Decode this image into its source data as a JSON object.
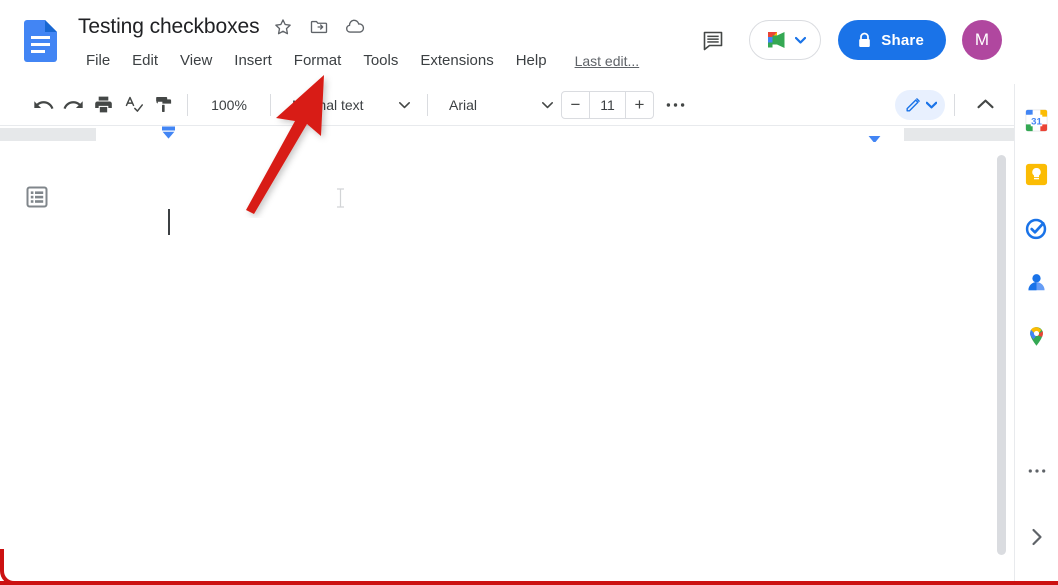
{
  "app": {
    "name": "Google Docs",
    "logo_icon": "google-docs-logo"
  },
  "header": {
    "doc_title": "Testing checkboxes",
    "title_icons": [
      {
        "name": "star-icon",
        "label": "Star"
      },
      {
        "name": "move-to-folder-icon",
        "label": "Move"
      },
      {
        "name": "cloud-saved-icon",
        "label": "See document status"
      }
    ],
    "menus": [
      {
        "label": "File"
      },
      {
        "label": "Edit"
      },
      {
        "label": "View"
      },
      {
        "label": "Insert"
      },
      {
        "label": "Format"
      },
      {
        "label": "Tools"
      },
      {
        "label": "Extensions"
      },
      {
        "label": "Help"
      }
    ],
    "last_edit": "Last edit...",
    "comment_icon": "comment-history-icon",
    "meet_icon": "google-meet-icon",
    "meet_caret_icon": "chevron-down-icon",
    "share_label": "Share",
    "share_lock_icon": "lock-icon",
    "avatar_initial": "M",
    "avatar_color": "#b0479f",
    "share_color": "#1a73e8"
  },
  "toolbar": {
    "undo_icon": "undo-icon",
    "redo_icon": "redo-icon",
    "print_icon": "print-icon",
    "spellcheck_icon": "spellcheck-icon",
    "paint_format_icon": "paint-format-icon",
    "zoom_value": "100%",
    "paragraph_style": "Normal text",
    "style_caret_icon": "chevron-down-icon",
    "font_family": "Arial",
    "font_caret_icon": "chevron-down-icon",
    "font_size_decrease": "−",
    "font_size_value": "11",
    "font_size_increase": "+",
    "more_icon": "more-horizontal-icon",
    "edit_mode_icon": "pencil-edit-icon",
    "edit_mode_caret_icon": "chevron-down-icon",
    "collapse_icon": "chevron-up-icon"
  },
  "ruler": {
    "left_indent_marker": "left-indent-marker",
    "right_indent_marker": "right-indent-marker"
  },
  "document": {
    "outline_toggle_icon": "document-outline-icon",
    "caret": "text-cursor",
    "body_text": ""
  },
  "side_panel": {
    "items": [
      {
        "name": "google-calendar-icon",
        "label": "Calendar",
        "badge": "31"
      },
      {
        "name": "google-keep-icon",
        "label": "Keep"
      },
      {
        "name": "google-tasks-icon",
        "label": "Tasks"
      },
      {
        "name": "google-contacts-icon",
        "label": "Contacts"
      },
      {
        "name": "google-maps-icon",
        "label": "Maps"
      }
    ],
    "more_icon": "more-vertical-icon",
    "expand_icon": "chevron-right-icon"
  },
  "annotation": {
    "arrow_color": "#d81f16",
    "points_at": "Format"
  },
  "scrollbar": {
    "orientation": "vertical",
    "thumb_position_percent": 0
  }
}
